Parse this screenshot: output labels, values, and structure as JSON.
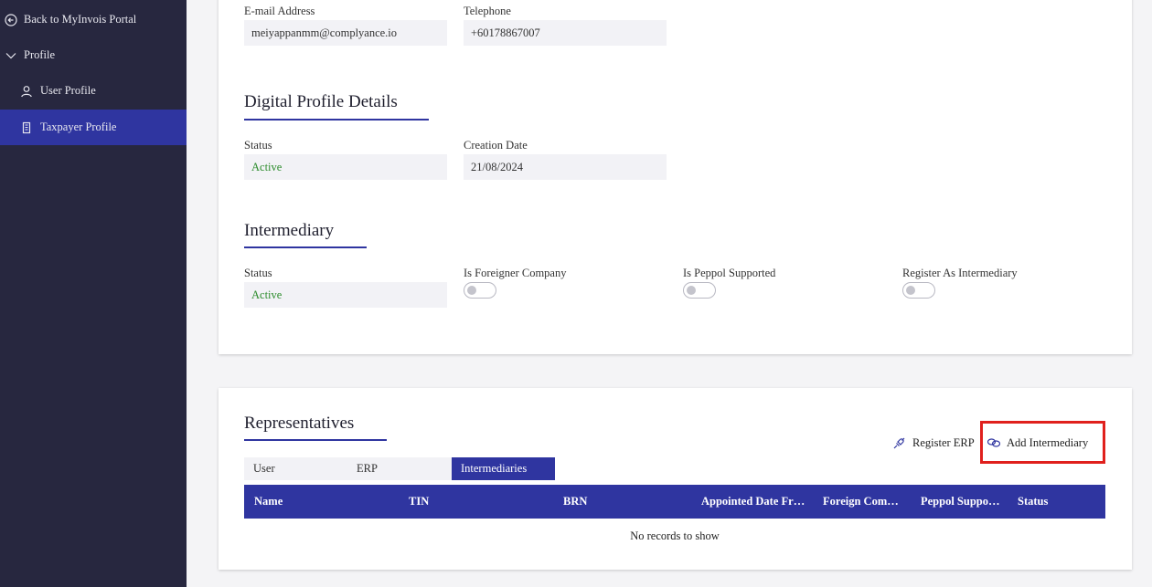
{
  "sidebar": {
    "back_label": "Back to MyInvois Portal",
    "profile_label": "Profile",
    "items": [
      {
        "label": "User Profile",
        "icon": "user-icon"
      },
      {
        "label": "Taxpayer Profile",
        "icon": "building-icon",
        "active": true
      }
    ]
  },
  "contact": {
    "email_label": "E-mail Address",
    "email_value": "meiyappanmm@complyance.io",
    "phone_label": "Telephone",
    "phone_value": "+60178867007"
  },
  "digital_profile": {
    "title": "Digital Profile Details",
    "status_label": "Status",
    "status_value": "Active",
    "creation_label": "Creation Date",
    "creation_value": "21/08/2024"
  },
  "intermediary": {
    "title": "Intermediary",
    "status_label": "Status",
    "status_value": "Active",
    "foreigner_label": "Is Foreigner Company",
    "foreigner_on": false,
    "peppol_label": "Is Peppol Supported",
    "peppol_on": false,
    "register_label": "Register As Intermediary",
    "register_on": false
  },
  "representatives": {
    "title": "Representatives",
    "register_erp_label": "Register ERP",
    "add_intermediary_label": "Add Intermediary",
    "tabs": [
      {
        "label": "User"
      },
      {
        "label": "ERP"
      },
      {
        "label": "Intermediaries",
        "active": true
      }
    ],
    "columns": [
      "Name",
      "TIN",
      "BRN",
      "Appointed Date Fr…",
      "Foreign Com…",
      "Peppol Suppo…",
      "Status"
    ],
    "empty_message": "No records to show"
  },
  "colors": {
    "sidebar_bg": "#27273f",
    "accent": "#2f35a0",
    "active_green": "#2c8c2c",
    "highlight_red": "#e0201d"
  }
}
